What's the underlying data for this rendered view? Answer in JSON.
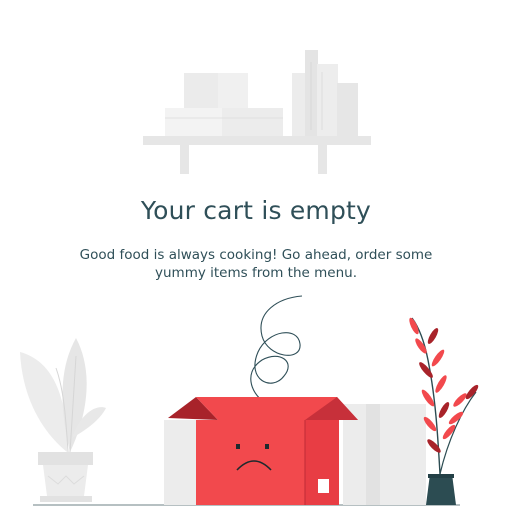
{
  "empty_state": {
    "title": "Your cart is empty",
    "message": "Good food is always cooking! Go ahead, order some yummy items from the menu."
  },
  "colors": {
    "text": "#2f4f58",
    "accent": "#f2494d",
    "accent_dark": "#a8232a",
    "gray_light": "#ececec",
    "gray_mid": "#e2e2e2",
    "pot": "#2c4c52"
  },
  "icons": [
    "shelf-illustration",
    "box-illustration",
    "plant-illustration",
    "vase-illustration"
  ]
}
